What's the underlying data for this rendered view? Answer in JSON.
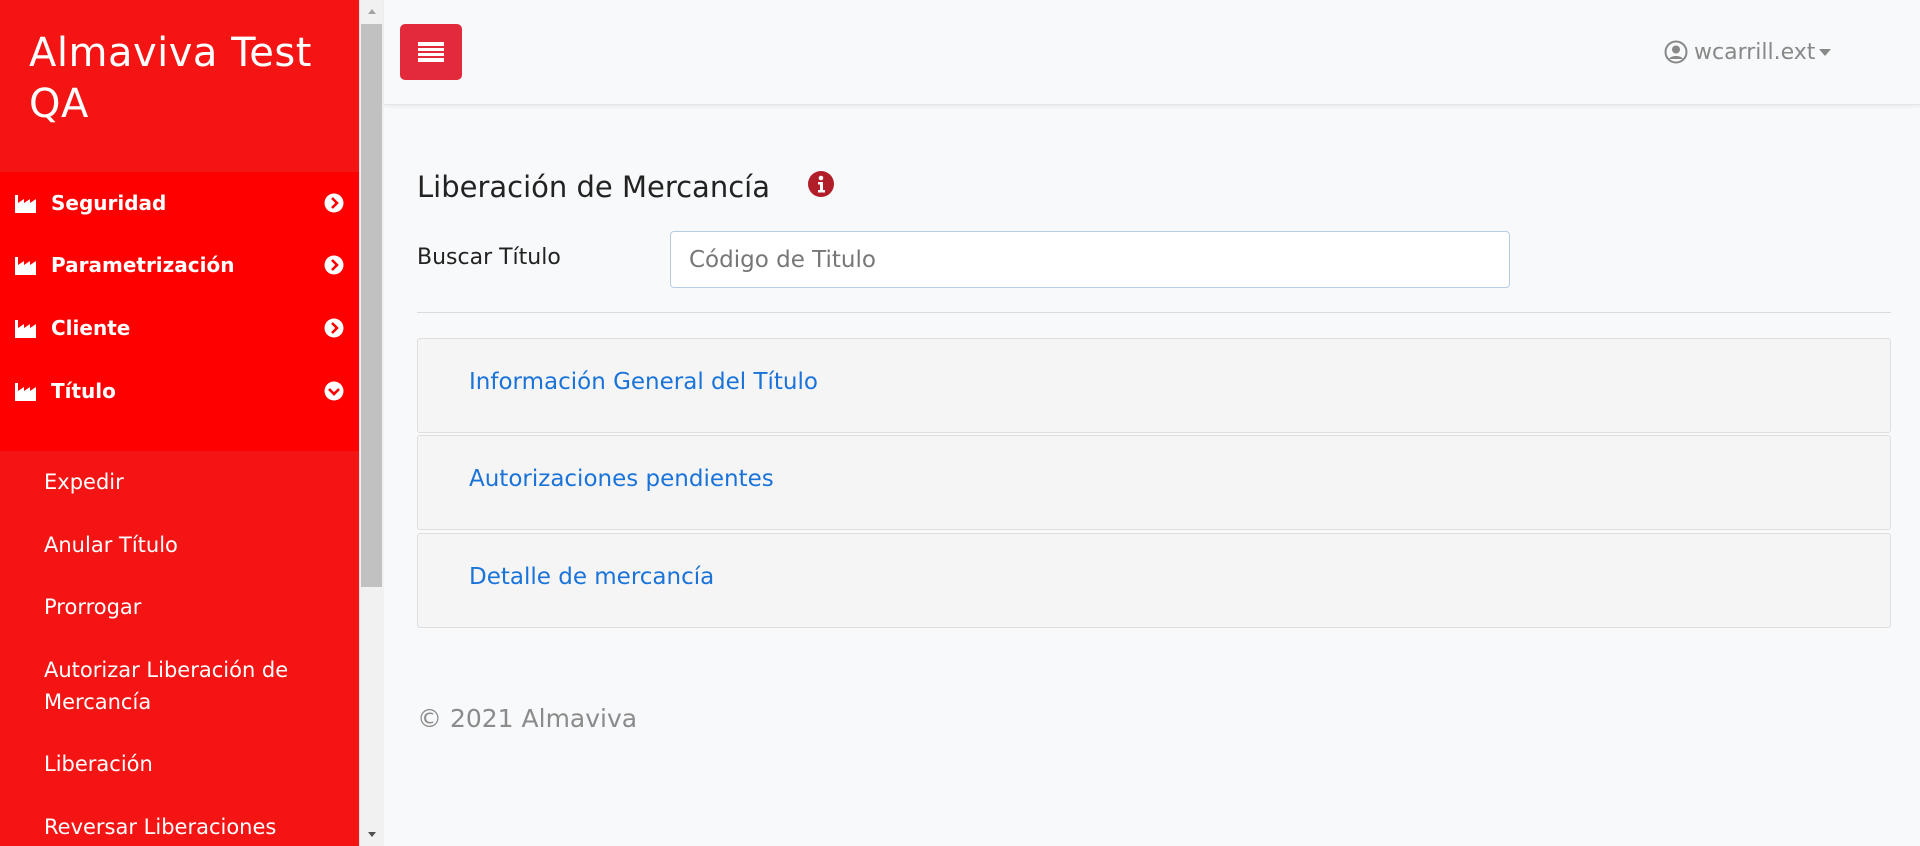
{
  "app": {
    "brand": "Almaviva Test QA"
  },
  "sidebar": {
    "menu": [
      {
        "label": "Seguridad",
        "icon": "factory-icon",
        "state": "collapsed"
      },
      {
        "label": "Parametrización",
        "icon": "factory-icon",
        "state": "collapsed"
      },
      {
        "label": "Cliente",
        "icon": "factory-icon",
        "state": "collapsed"
      },
      {
        "label": "Título",
        "icon": "factory-icon",
        "state": "expanded"
      }
    ],
    "submenu": [
      {
        "label": "Expedir"
      },
      {
        "label": "Anular Título"
      },
      {
        "label": "Prorrogar"
      },
      {
        "label": "Autorizar Liberación de Mercancía"
      },
      {
        "label": "Liberación"
      },
      {
        "label": "Reversar Liberaciones"
      }
    ]
  },
  "topbar": {
    "toggle_icon": "menu-list-icon",
    "user": "wcarrill.ext"
  },
  "main": {
    "title": "Liberación de Mercancía",
    "search": {
      "label": "Buscar Título",
      "placeholder": "Código de Titulo",
      "value": ""
    },
    "panels": [
      {
        "label": "Información General del Título"
      },
      {
        "label": "Autorizaciones pendientes"
      },
      {
        "label": "Detalle de mercancía"
      }
    ],
    "footer": "© 2021 Almaviva"
  },
  "colors": {
    "sidebar_bg": "#f41414",
    "menu_bg": "#ff0000",
    "toggle_bg": "#e32a3b",
    "link": "#1a73d9",
    "info_icon": "#b21d2a"
  }
}
